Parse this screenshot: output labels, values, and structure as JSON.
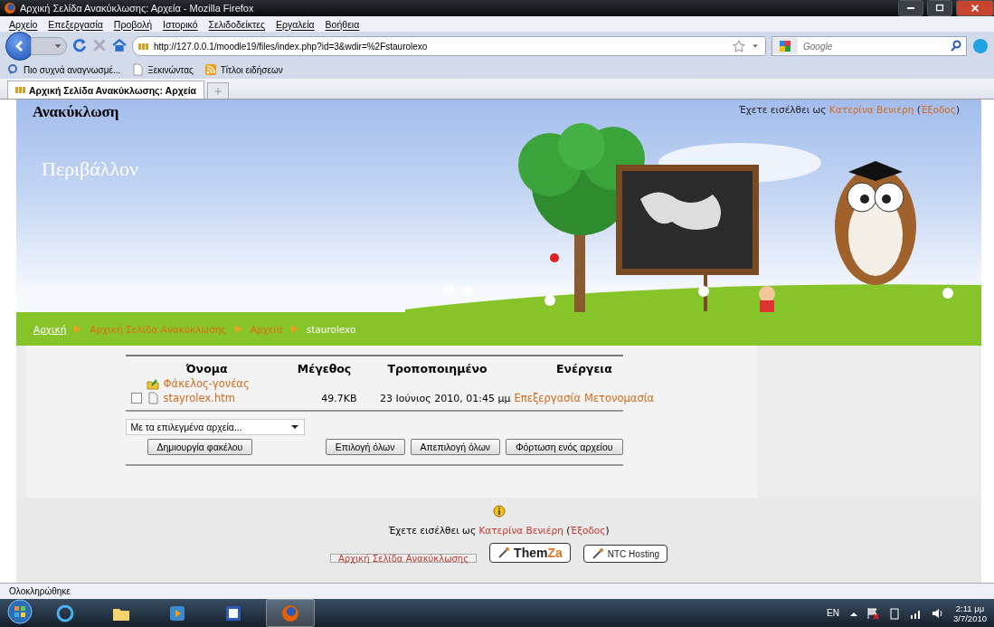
{
  "window": {
    "title": "Αρχική Σελίδα Ανακύκλωσης: Αρχεία - Mozilla Firefox"
  },
  "menu": [
    "Αρχείο",
    "Επεξεργασία",
    "Προβολή",
    "Ιστορικό",
    "Σελιδοδείκτες",
    "Εργαλεία",
    "Βοήθεια"
  ],
  "toolbar": {
    "url": "http://127.0.0.1/moodle19/files/index.php?id=3&wdir=%2Fstaurolexo",
    "search_placeholder": "Google"
  },
  "bookmarks": [
    {
      "kind": "search",
      "label": "Πιο συχνά αναγνωσμέ..."
    },
    {
      "kind": "page",
      "label": "Ξεκινώντας"
    },
    {
      "kind": "feed",
      "label": "Τίτλοι ειδήσεων"
    }
  ],
  "tabs": [
    {
      "label": "Αρχική Σελίδα Ανακύκλωσης: Αρχεία",
      "selected": true
    }
  ],
  "page": {
    "site_name": "Ανακύκλωση",
    "banner_title": "Περιβάλλον",
    "login": {
      "prefix": "Έχετε εισέλθει ως",
      "user": "Κατερίνα Βενιέρη",
      "open": "(",
      "logout": "Έξοδος",
      "close": ")"
    },
    "breadcrumb": [
      {
        "label": "Αρχική",
        "current": false
      },
      {
        "label": "Αρχική Σελίδα Ανακύκλωσης",
        "current": false
      },
      {
        "label": "Αρχεία",
        "current": false
      },
      {
        "label": "staurolexo",
        "current": true
      }
    ],
    "table": {
      "columns": [
        "Όνομα",
        "Μέγεθος",
        "Τροποποιημένο",
        "Ενέργεια"
      ],
      "rows": [
        {
          "kind": "parent",
          "name": "Φάκελος-γονέας"
        },
        {
          "kind": "file",
          "name": "stayrolex.htm",
          "checked": false,
          "size": "49.7KB",
          "modified": "23 Ιούνιος 2010, 01:45 μμ",
          "actions": [
            "Επεξεργασία",
            "Μετονομασία"
          ]
        }
      ]
    },
    "bulk_select": "Με τα επιλεγμένα αρχεία...",
    "buttons": [
      "Δημιουργία φακέλου",
      "Επιλογή όλων",
      "Απεπιλογή όλων",
      "Φόρτωση ενός αρχείου"
    ],
    "footer": {
      "login": {
        "prefix": "Έχετε εισέλθει ως",
        "user": "Κατερίνα Βενιέρη",
        "open": "(",
        "logout": "Έξοδος",
        "close": ")"
      },
      "home_link": "Αρχική Σελίδα Ανακύκλωσης",
      "logos": [
        {
          "main": "Them",
          "accent": "Za"
        },
        {
          "main": "NTC Hosting"
        }
      ]
    }
  },
  "status_bar": "Ολοκληρώθηκε",
  "taskbar": {
    "language": "EN",
    "time": "2:11 μμ",
    "date": "3/7/2010"
  }
}
